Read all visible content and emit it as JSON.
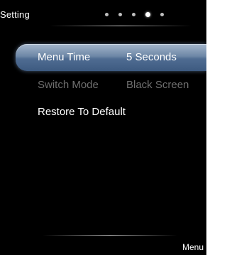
{
  "header": {
    "title": "Setting",
    "page_indicator": {
      "total_pages": 5,
      "current_page": 4
    }
  },
  "menu": {
    "items": [
      {
        "label": "Menu Time",
        "value": "5 Seconds",
        "state": "selected"
      },
      {
        "label": "Switch Mode",
        "value": "Black Screen",
        "state": "disabled"
      },
      {
        "label": "Restore To Default",
        "value": "",
        "state": "normal"
      }
    ]
  },
  "footer": {
    "hint": "Menu"
  },
  "colors": {
    "background": "#000000",
    "text": "#ffffff",
    "disabled_text": "#6f6f6f",
    "highlight_top": "#a4b6cc",
    "highlight_bottom": "#3d5a80"
  }
}
